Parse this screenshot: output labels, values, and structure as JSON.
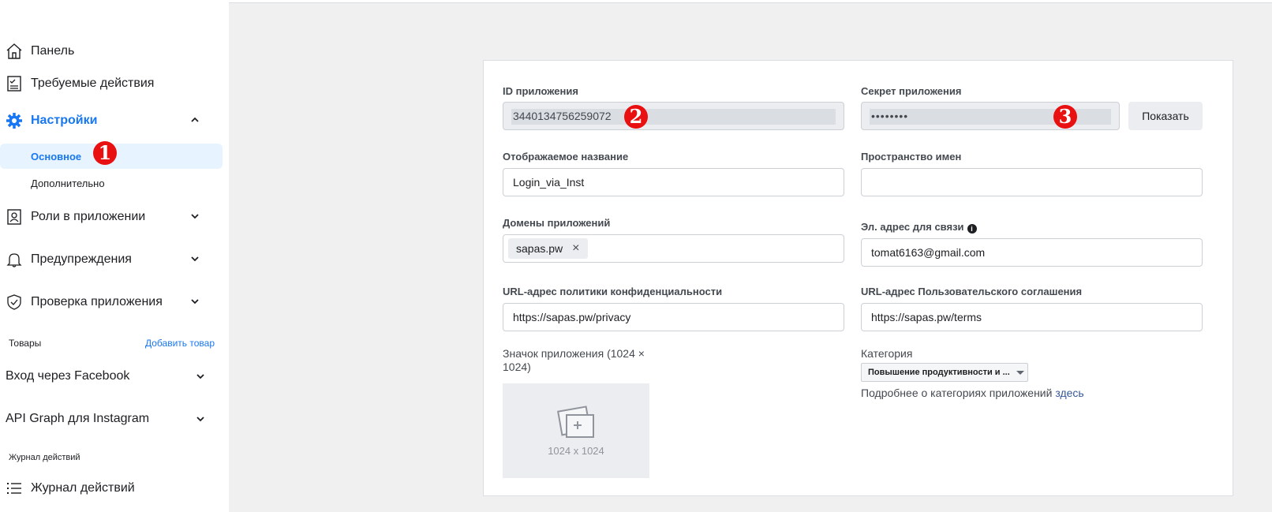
{
  "sidebar": {
    "items": [
      {
        "label": "Панель",
        "icon": "home-icon"
      },
      {
        "label": "Требуемые действия",
        "icon": "checklist-icon"
      },
      {
        "label": "Настройки",
        "icon": "gear-icon",
        "active": true
      },
      {
        "label": "Роли в приложении",
        "icon": "roles-icon"
      },
      {
        "label": "Предупреждения",
        "icon": "bell-icon"
      },
      {
        "label": "Проверка приложения",
        "icon": "shield-check-icon"
      }
    ],
    "settings_sub": [
      "Основное",
      "Дополнительно"
    ],
    "products_label": "Товары",
    "add_product": "Добавить товар",
    "products": [
      "Вход через Facebook",
      "API Graph для Instagram"
    ],
    "activity_label": "Журнал действий",
    "activity_item": "Журнал действий"
  },
  "markers": [
    "1",
    "2",
    "3"
  ],
  "form": {
    "app_id": {
      "label": "ID приложения",
      "value": "3440134756259072"
    },
    "app_secret": {
      "label": "Секрет приложения",
      "value": "••••••••",
      "show_button": "Показать"
    },
    "display_name": {
      "label": "Отображаемое название",
      "value": "Login_via_Inst"
    },
    "namespace": {
      "label": "Пространство имен",
      "value": ""
    },
    "app_domains": {
      "label": "Домены приложений",
      "chip": "sapas.pw",
      "chip_remove": "×"
    },
    "contact_email": {
      "label": "Эл. адрес для связи",
      "info": "i",
      "value": "tomat6163@gmail.com"
    },
    "privacy_url": {
      "label": "URL-адрес политики конфиденциальности",
      "value": "https://sapas.pw/privacy"
    },
    "terms_url": {
      "label": "URL-адрес Пользовательского соглашения",
      "value": "https://sapas.pw/terms"
    },
    "app_icon": {
      "label_line1": "Значок приложения (1024 ×",
      "label_line2": "1024)",
      "placeholder": "1024 x 1024"
    },
    "category": {
      "label": "Категория",
      "value": "Повышение продуктивности и ...",
      "help_text": "Подробнее о категориях приложений",
      "help_link": "здесь"
    }
  },
  "colors": {
    "accent": "#1877f2",
    "marker": "#e81010",
    "page_bg": "#f0f0f0"
  }
}
